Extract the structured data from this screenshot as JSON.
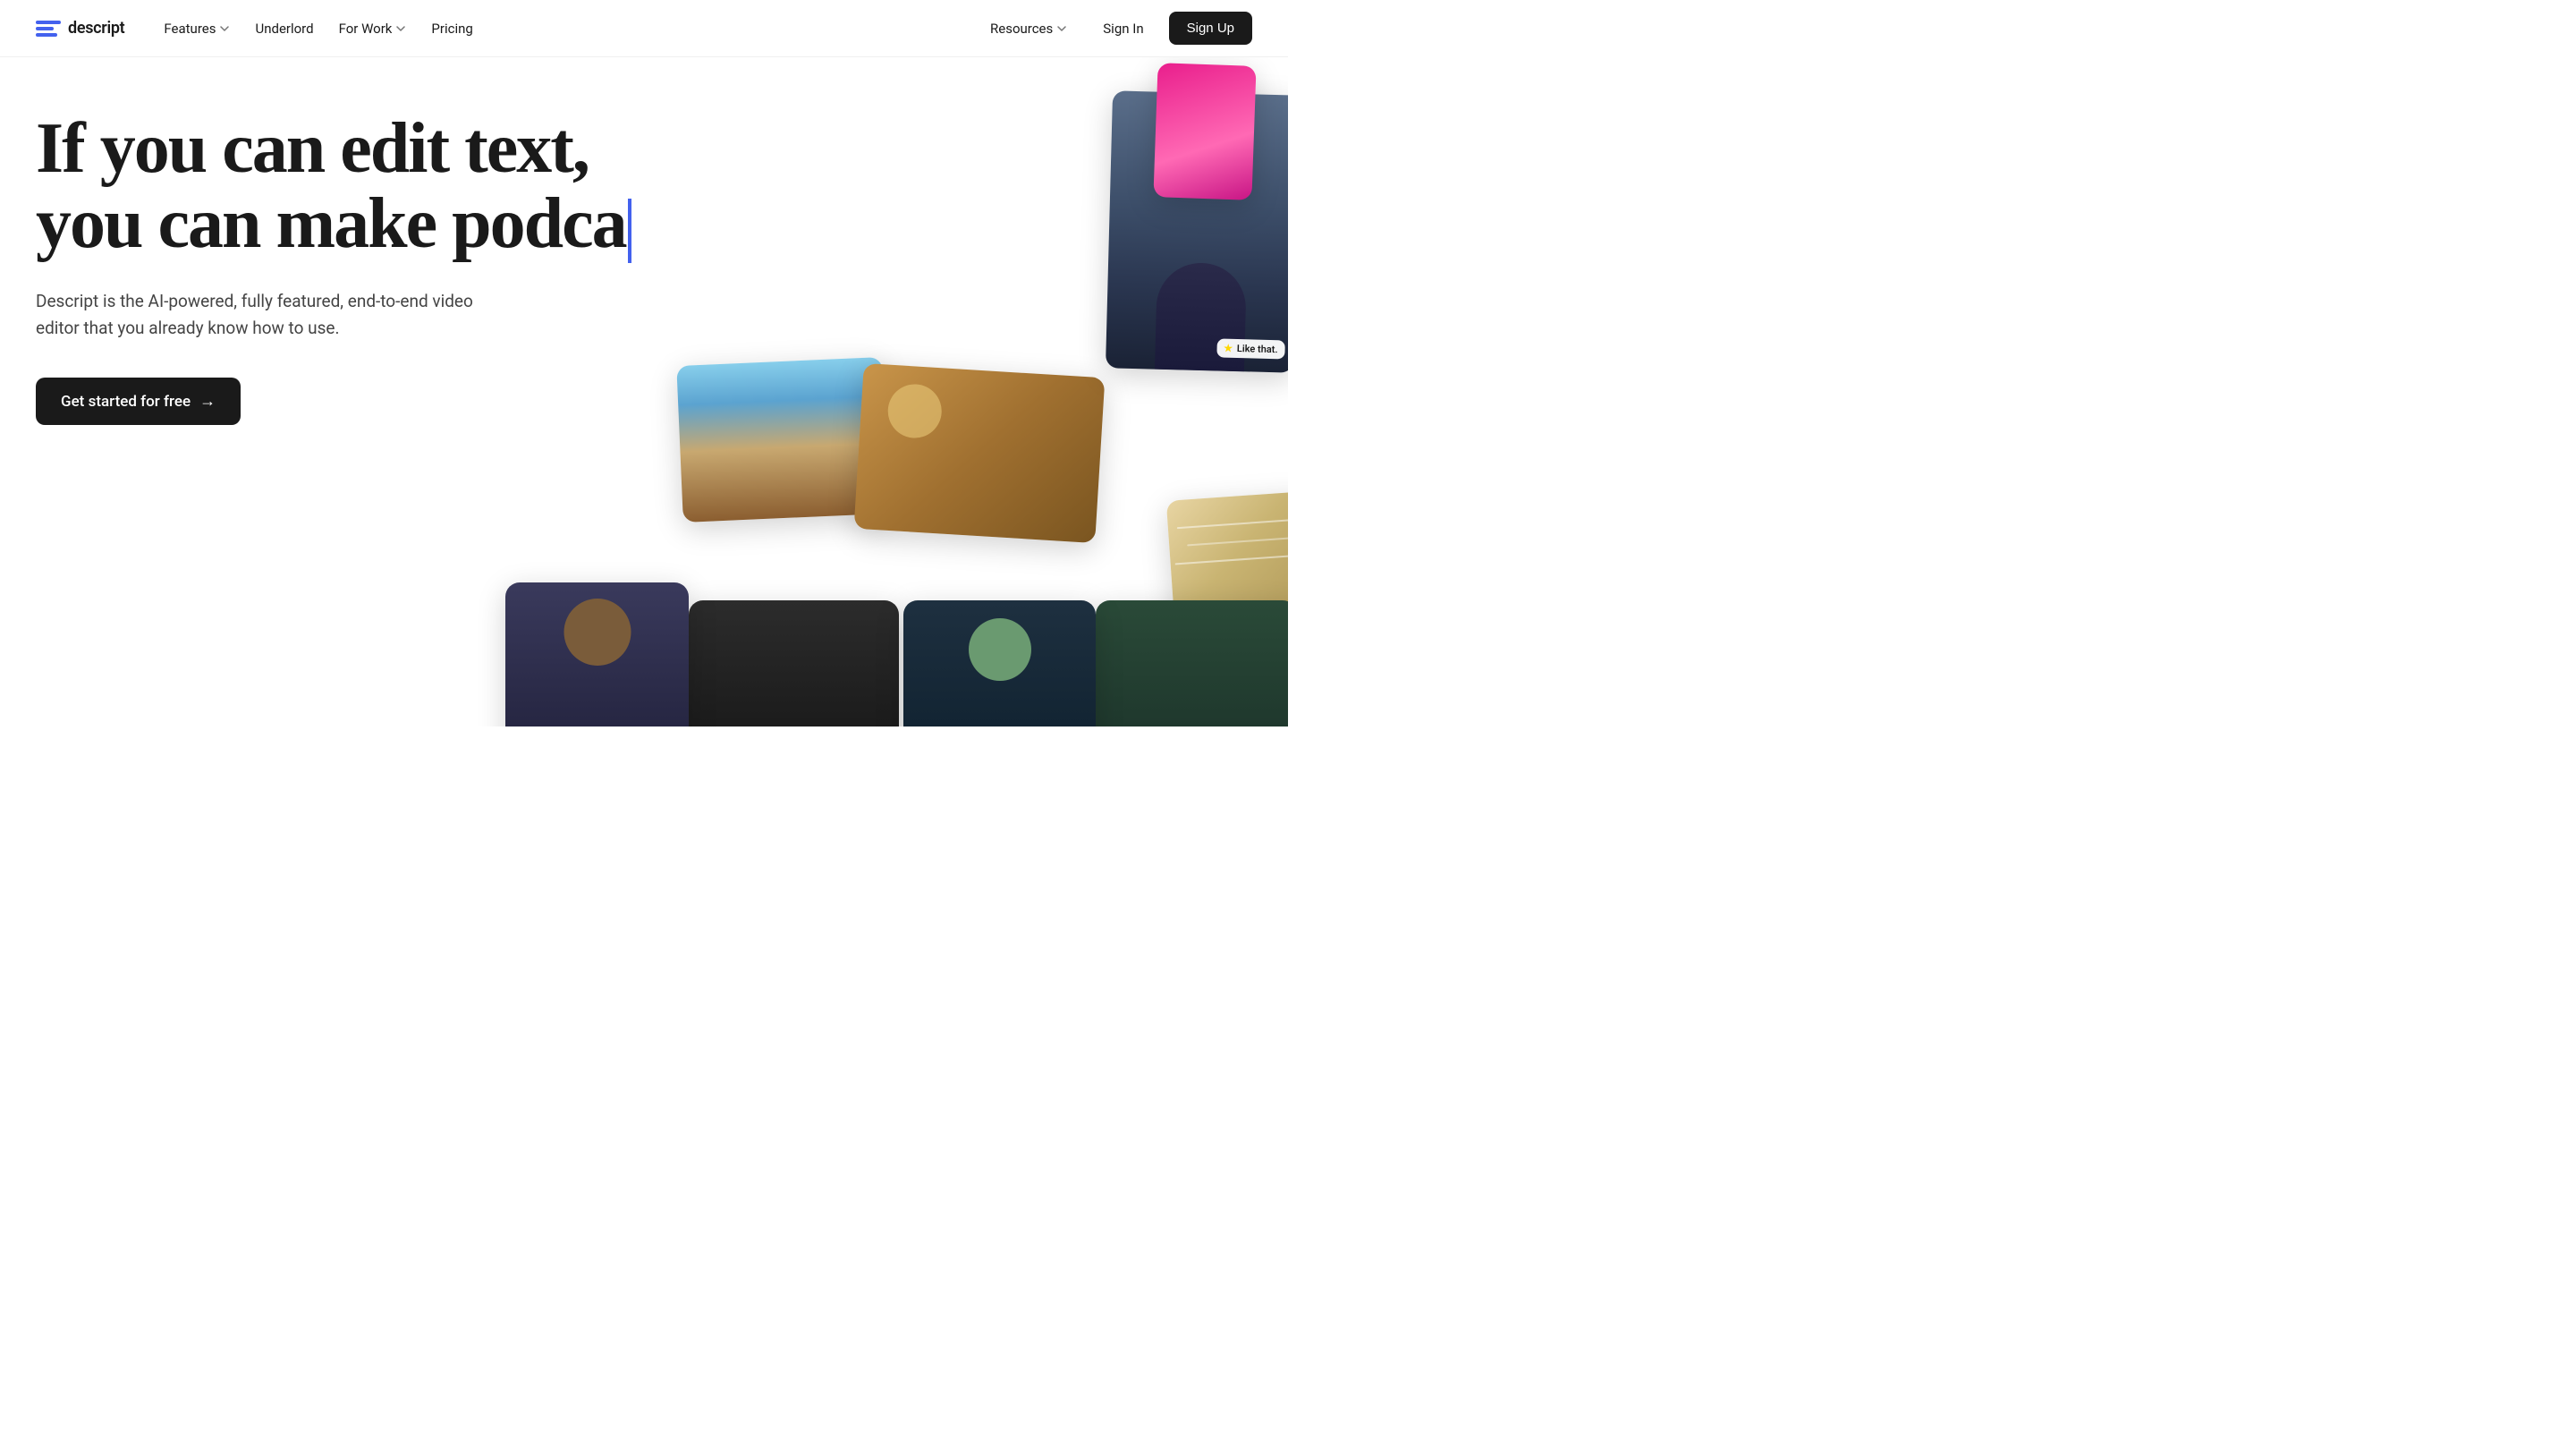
{
  "nav": {
    "logo_text": "descript",
    "links": [
      {
        "label": "Features",
        "has_dropdown": true
      },
      {
        "label": "Underlord",
        "has_dropdown": false
      },
      {
        "label": "For Work",
        "has_dropdown": true
      },
      {
        "label": "Pricing",
        "has_dropdown": false
      }
    ],
    "right": {
      "resources_label": "Resources",
      "sign_in_label": "Sign In",
      "sign_up_label": "Sign Up"
    }
  },
  "hero": {
    "headline_line1": "If you can edit text,",
    "headline_line2": "you can make podca",
    "subtext": "Descript is the AI-powered, fully featured, end-to-end video editor that you already know how to use.",
    "cta_label": "Get started for free",
    "cta_arrow": "→"
  },
  "thumbnails": [
    {
      "id": "thumb-pink",
      "alt": "pink thumbnail"
    },
    {
      "id": "thumb-person-top",
      "alt": "person portrait top right"
    },
    {
      "id": "thumb-room",
      "alt": "room interior"
    },
    {
      "id": "thumb-desert",
      "alt": "desert landscape"
    },
    {
      "id": "thumb-person-bottom-left",
      "alt": "person with glasses"
    },
    {
      "id": "thumb-dark-scene",
      "alt": "dark indoor scene"
    },
    {
      "id": "thumb-concert",
      "alt": "person with headphones"
    },
    {
      "id": "thumb-green-bg",
      "alt": "person on green background"
    },
    {
      "id": "thumb-map",
      "alt": "map view"
    }
  ],
  "like_badge": {
    "star": "★",
    "text": "Like that."
  }
}
